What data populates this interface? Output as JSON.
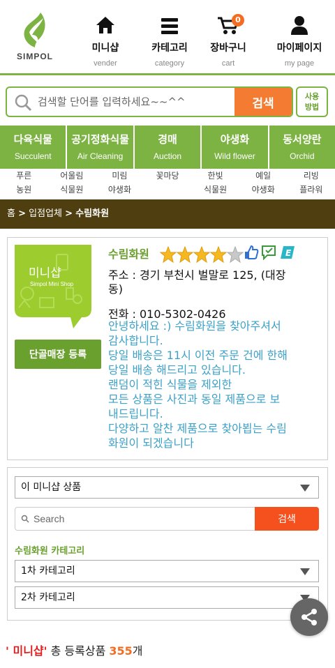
{
  "header": {
    "logo_text": "SIMPOL",
    "nav": [
      {
        "label": "미니샵",
        "sub": "vender",
        "icon": "home-icon"
      },
      {
        "label": "카테고리",
        "sub": "category",
        "icon": "menu-icon"
      },
      {
        "label": "장바구니",
        "sub": "cart",
        "icon": "cart-icon",
        "badge": "0"
      },
      {
        "label": "마이페이지",
        "sub": "my page",
        "icon": "user-icon"
      }
    ]
  },
  "search": {
    "placeholder": "검색할 단어를 입력하세요~~^^",
    "button": "검색",
    "usage_line1": "사용",
    "usage_line2": "방법"
  },
  "categories": [
    {
      "ko": "다육식물",
      "en": "Succulent"
    },
    {
      "ko": "공기정화식물",
      "en": "Air Cleaning"
    },
    {
      "ko": "경매",
      "en": "Auction"
    },
    {
      "ko": "야생화",
      "en": "Wild flower"
    },
    {
      "ko": "동서양란",
      "en": "Orchid"
    }
  ],
  "sublinks": [
    {
      "l1": "푸른",
      "l2": "농원"
    },
    {
      "l1": "어울림",
      "l2": "식물원"
    },
    {
      "l1": "미림",
      "l2": "야생화"
    },
    {
      "l1": "꽃마당",
      "l2": ""
    },
    {
      "l1": "한빛",
      "l2": "식물원"
    },
    {
      "l1": "예일",
      "l2": "야생화"
    },
    {
      "l1": "리빙",
      "l2": "플라워"
    }
  ],
  "breadcrumb": {
    "home": "홈",
    "sep": ">",
    "level1": "입점업체",
    "current": "수림화원"
  },
  "shop": {
    "name": "수림화원",
    "rating": 4,
    "rating_max": 5,
    "image_text_line1": "미니샵",
    "image_text_line2": "Simpol Mini Shop",
    "register_button": "단골매장 등록",
    "address_line1": "주소 : 경기 부천시 벌말로 125, (대장",
    "address_line2": "동)",
    "phone": "전화 : 010-5302-0426",
    "description": [
      "안녕하세요 :) 수림화원을 찾아주셔서",
      "감사합니다.",
      "당일 배송은 11시 이전 주문 건에 한해",
      "당일 배송 해드리고 있습니다.",
      "랜덤이 적힌 식물을 제외한",
      "모든 상품은 사진과 동일 제품으로 보",
      "내드립니다.",
      "다양하고 알찬 제품으로 찾아뵙는 수림",
      "화원이 되겠습니다"
    ]
  },
  "minishop": {
    "scope_select": "이 미니샵 상품",
    "search_placeholder": "Search",
    "search_button": "검색",
    "category_title": "수림화원 카테고리",
    "category1": "1차 카테고리",
    "category2": "2차 카테고리"
  },
  "footer": {
    "prefix": "' 미니샵'",
    "label": " 총 등록상품 ",
    "count": "355",
    "unit": "개"
  },
  "colors": {
    "brand_green": "#7cb342",
    "dark_brown": "#4f3f10",
    "orange": "#f37b32",
    "desc_blue": "#3ca1c8"
  }
}
